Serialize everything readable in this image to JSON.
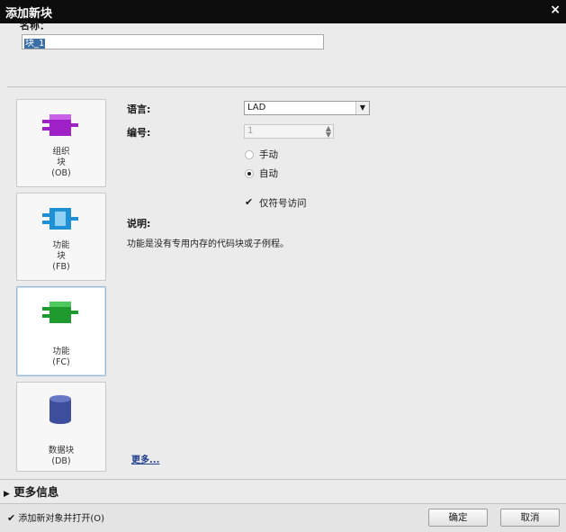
{
  "window": {
    "title": "添加新块",
    "close_glyph": "×"
  },
  "name": {
    "label": "名称：",
    "value": "块_1"
  },
  "blocks": [
    {
      "label": "组织\n块\n(OB)",
      "icon": "ob-block-icon",
      "color": "#a020c8"
    },
    {
      "label": "功能\n块\n(FB)",
      "icon": "fb-block-icon",
      "color": "#1e90d6"
    },
    {
      "label": "功能\n(FC)",
      "icon": "fc-block-icon",
      "color": "#1f9a2e",
      "selected": true
    },
    {
      "label": "数据块\n(DB)",
      "icon": "db-cylinder-icon",
      "color": "#3c4e9c"
    }
  ],
  "language": {
    "label": "语言:",
    "value": "LAD"
  },
  "number": {
    "label": "编号:",
    "value": "1",
    "options": [
      {
        "label": "手动",
        "checked": false
      },
      {
        "label": "自动",
        "checked": true
      }
    ]
  },
  "symbolic_access": {
    "label": "仅符号访问",
    "checked": true
  },
  "description": {
    "label": "说明:",
    "text": "功能是没有专用内存的代码块或子例程。"
  },
  "more_link": "更多...",
  "more_info": {
    "label": "更多信息",
    "arrow": "▶"
  },
  "footer": {
    "open_checkbox_label": "添加新对象并打开(O)",
    "ok_label": "确定",
    "cancel_label": "取消"
  }
}
